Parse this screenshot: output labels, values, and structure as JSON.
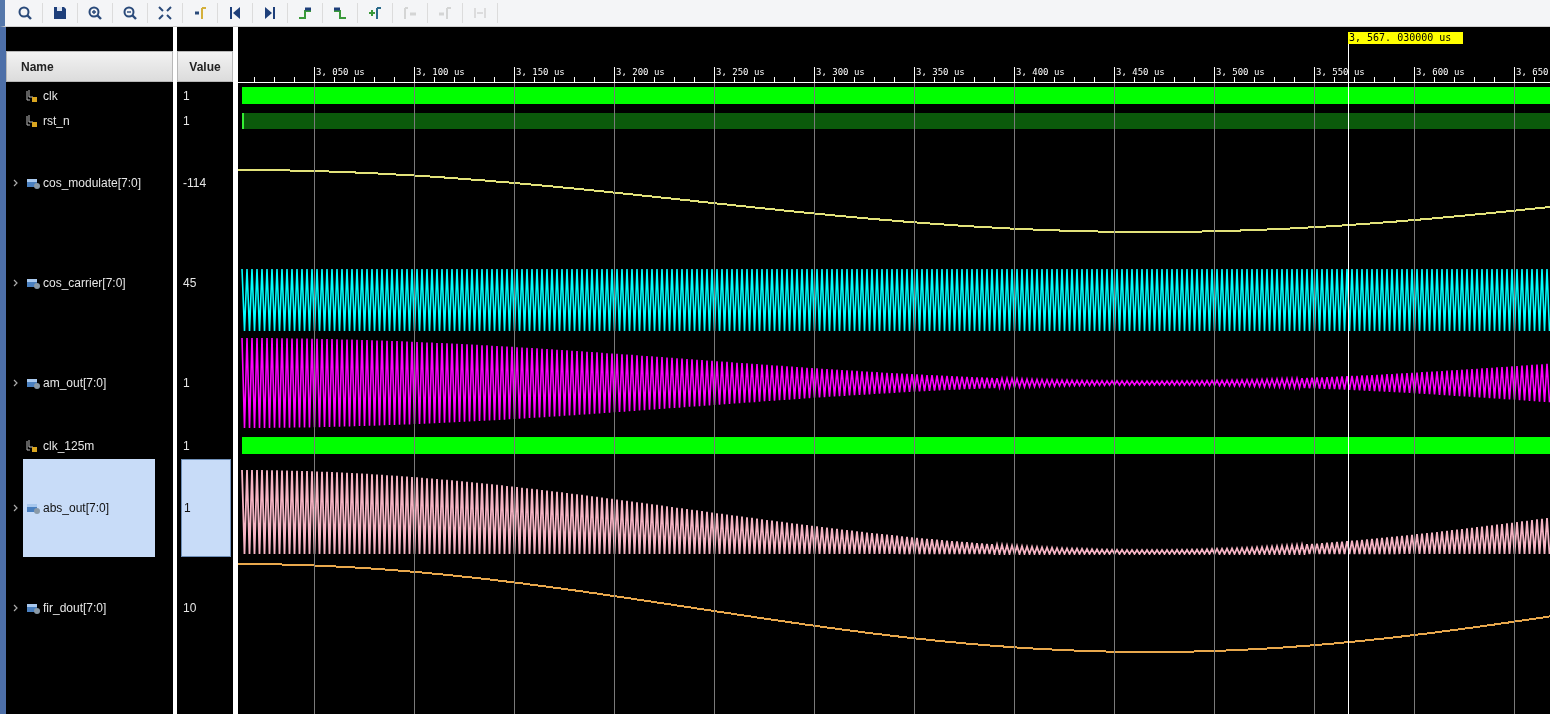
{
  "toolbar": [
    {
      "disabled": false
    },
    {
      "disabled": false
    },
    {
      "disabled": false
    },
    {
      "disabled": false
    },
    {
      "disabled": false
    },
    {
      "disabled": false
    },
    {
      "disabled": false
    },
    {
      "disabled": false
    },
    {
      "disabled": false
    },
    {
      "disabled": false
    },
    {
      "disabled": false
    },
    {
      "disabled": true
    },
    {
      "disabled": true
    },
    {
      "disabled": true
    }
  ],
  "columns": {
    "name": "Name",
    "value": "Value"
  },
  "ruler": {
    "ticks": [
      "3, 050 us",
      "3, 100 us",
      "3, 150 us",
      "3, 200 us",
      "3, 250 us",
      "3, 300 us",
      "3, 350 us",
      "3, 400 us",
      "3, 450 us",
      "3, 500 us",
      "3, 550 us",
      "3, 600 us",
      "3, 650"
    ],
    "cursor": "3, 567. 030000 us"
  },
  "signals": [
    {
      "name": "clk",
      "value": "1",
      "kind": "clock",
      "expandable": false,
      "selected": false,
      "color": "#00ff00"
    },
    {
      "name": "rst_n",
      "value": "1",
      "kind": "level",
      "expandable": false,
      "selected": false,
      "color": "#0b5a0b"
    },
    {
      "name": "cos_modulate[7:0]",
      "value": "-114",
      "kind": "trace",
      "expandable": true,
      "selected": false,
      "color": "#e2e27a"
    },
    {
      "name": "cos_carrier[7:0]",
      "value": "45",
      "kind": "carrier",
      "expandable": true,
      "selected": false,
      "color": "#00ffff"
    },
    {
      "name": "am_out[7:0]",
      "value": "1",
      "kind": "envelope",
      "expandable": true,
      "selected": false,
      "color": "#ff00ff"
    },
    {
      "name": "clk_125m",
      "value": "1",
      "kind": "clock",
      "expandable": false,
      "selected": false,
      "color": "#00ff00"
    },
    {
      "name": "abs_out[7:0]",
      "value": "1",
      "kind": "rectified",
      "expandable": true,
      "selected": true,
      "color": "#f5b3c3"
    },
    {
      "name": "fir_dout[7:0]",
      "value": "10",
      "kind": "trace2",
      "expandable": true,
      "selected": false,
      "color": "#e8a84c"
    }
  ]
}
